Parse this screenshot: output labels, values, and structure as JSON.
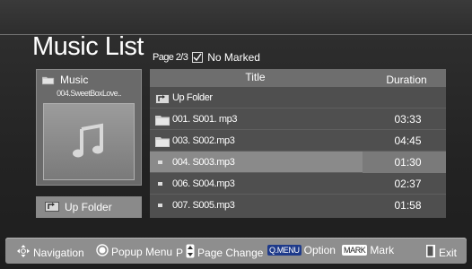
{
  "app": {
    "title": "Music List"
  },
  "page": {
    "info": "Page 2/3",
    "no_marked": "No Marked"
  },
  "left_panel": {
    "category": "Music",
    "current_song": "004.SweetBoxLove..",
    "up_folder_label": "Up Folder"
  },
  "list": {
    "headers": {
      "title": "Title",
      "duration": "Duration"
    },
    "rows": [
      {
        "name": "Up Folder",
        "duration": "",
        "type": "up-folder"
      },
      {
        "name": "001. S001. mp3",
        "duration": "03:33",
        "type": "folder"
      },
      {
        "name": "003. S002.mp3",
        "duration": "04:45",
        "type": "folder"
      },
      {
        "name": "004. S003.mp3",
        "duration": "01:30",
        "type": "file",
        "selected": true
      },
      {
        "name": "006. S004.mp3",
        "duration": "02:37",
        "type": "file"
      },
      {
        "name": "007. S005.mp3",
        "duration": "01:58",
        "type": "file"
      }
    ]
  },
  "footer": {
    "navigation": "Navigation",
    "popup_menu": "Popup Menu",
    "page_key": "P",
    "page_change": "Page Change",
    "qmenu_key": "Q.MENU",
    "option": "Option",
    "mark_key": "MARK",
    "mark": "Mark",
    "exit": "Exit"
  },
  "colors": {
    "background": "#2a2a2a",
    "panel": "#6a6a6a",
    "list_bg": "#4f4f4f",
    "selected_row": "#8a8a8a",
    "footer_bg": "#8e8e8e",
    "qmenu_badge": "#1e3a8a"
  },
  "icons": {
    "check": "checkbox-icon",
    "folder": "folder-icon",
    "up_folder": "up-folder-icon",
    "music_note": "music-note-icon",
    "navigation": "navigation-arrows-icon",
    "popup": "circle-button-icon",
    "exit": "exit-door-icon"
  }
}
